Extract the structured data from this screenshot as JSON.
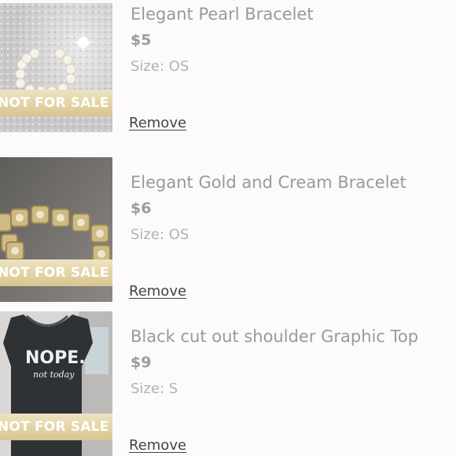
{
  "listings": [
    {
      "title": "Elegant Pearl Bracelet",
      "price": "$5",
      "size_label": "Size: OS",
      "ribbon": "NOT FOR SALE",
      "remove_label": "Remove"
    },
    {
      "title": "Elegant Gold and Cream Bracelet",
      "price": "$6",
      "size_label": "Size: OS",
      "ribbon": "NOT FOR SALE",
      "remove_label": "Remove"
    },
    {
      "title": "Black cut out shoulder Graphic Top",
      "price": "$9",
      "size_label": "Size: S",
      "ribbon": "NOT FOR SALE",
      "remove_label": "Remove",
      "shirt_text": "NOPE.",
      "shirt_subtext": "not today"
    }
  ]
}
